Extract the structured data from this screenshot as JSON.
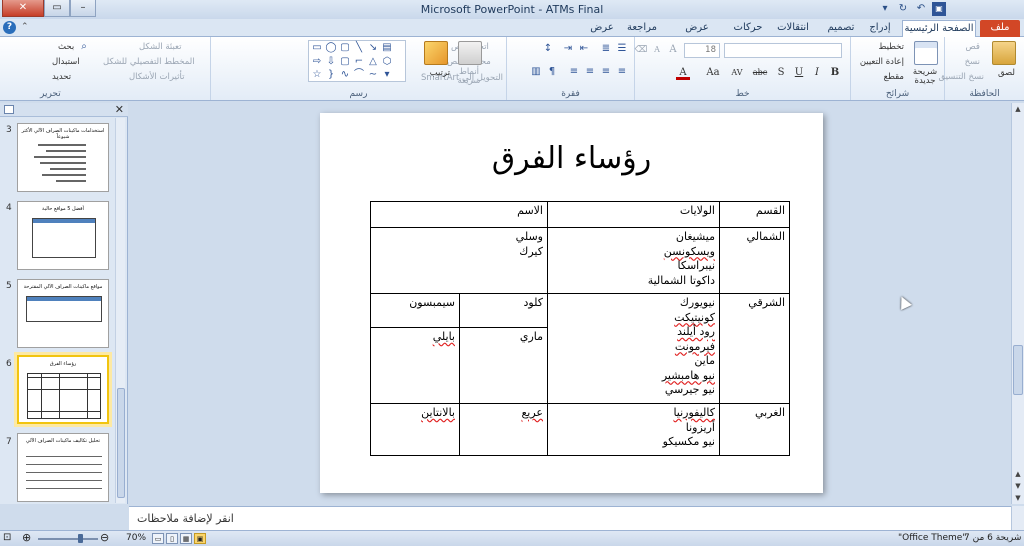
{
  "window": {
    "title": "Microsoft PowerPoint - ATMs Final",
    "controls": [
      "✕",
      "▭",
      "–"
    ]
  },
  "tabs": [
    {
      "id": "file",
      "label": "ملف"
    },
    {
      "id": "home",
      "label": "الصفحة الرئيسية"
    },
    {
      "id": "insert",
      "label": "إدراج"
    },
    {
      "id": "design",
      "label": "تصميم"
    },
    {
      "id": "transitions",
      "label": "انتقالات"
    },
    {
      "id": "animations",
      "label": "حركات"
    },
    {
      "id": "slideshow",
      "label": "عرض الشرائح"
    },
    {
      "id": "review",
      "label": "مراجعة"
    },
    {
      "id": "view",
      "label": "عرض"
    }
  ],
  "ribbon": {
    "clipboard": {
      "label": "الحافظة",
      "paste": "لصق",
      "cut": "قص",
      "copy": "نسخ",
      "format_painter": "نسخ التنسيق"
    },
    "slides": {
      "label": "شرائح",
      "new_slide": "شريحة جديدة",
      "layout": "تخطيط",
      "reset": "إعادة التعيين",
      "section": "مقطع"
    },
    "font": {
      "label": "خط",
      "size": "18",
      "bold": "B",
      "italic": "I",
      "underline": "U",
      "strike": "abc",
      "shadow": "S",
      "spacing": "AV",
      "case": "Aa",
      "color": "A",
      "grow": "A",
      "shrink": "A"
    },
    "paragraph": {
      "label": "فقرة",
      "text_direction": "اتجاه النص",
      "align_text": "محاذاة النص",
      "smartart": "التحويل إلى SmartArt"
    },
    "drawing": {
      "label": "رسم",
      "arrange": "ترتيب",
      "quick_styles": "أنماط سريعة",
      "shape_fill": "تعبئة الشكل",
      "shape_outline": "المخطط التفصيلي للشكل",
      "shape_effects": "تأثيرات الأشكال"
    },
    "editing": {
      "label": "تحرير",
      "find": "بحث",
      "replace": "استبدال",
      "select": "تحديد"
    }
  },
  "thumbnails": [
    {
      "num": "3",
      "title": "استخدامات ماكينات الصراف الآلي الأكثر شيوعاً"
    },
    {
      "num": "4",
      "title": "أفضل 5 مواقع حالية"
    },
    {
      "num": "5",
      "title": "مواقع ماكينات الصراف الآلي المقترحة"
    },
    {
      "num": "6",
      "title": "رؤساء الفرق"
    },
    {
      "num": "7",
      "title": "تحليل تكاليف ماكينات الصراف الآلي"
    }
  ],
  "slide": {
    "title": "رؤساء الفرق",
    "table": {
      "headers": {
        "division": "القسم",
        "states": "الولايات",
        "name": "الاسم"
      },
      "north": {
        "division": "الشمالي",
        "states": [
          "ميشيغان",
          "ويسكونسن",
          "نيبراسكا",
          "داكوتا الشمالية"
        ],
        "first": "وسلي",
        "last": "كيرك"
      },
      "east": {
        "division": "الشرقي",
        "states_a": [
          "نيويورك",
          "كونيتيكت"
        ],
        "states_b": [
          "رود أيلند",
          "فيرمونت",
          "ماين",
          "نيو هامبشير",
          "نيو جيرسي"
        ],
        "first_a": "كلود",
        "last_a": "سيمبسون",
        "first_b": "ماري",
        "last_b": "بايلي"
      },
      "west": {
        "division": "الغربي",
        "states": [
          "كاليفورنيا",
          "أريزونا",
          "نيو مكسيكو"
        ],
        "first": "عريع",
        "last": "بالانتاين"
      }
    }
  },
  "notes": {
    "placeholder": "انقر لإضافة ملاحظات"
  },
  "status": {
    "slide_info": "شريحة 6 من 7",
    "theme": "\"Office Theme\"",
    "zoom": "70%"
  }
}
